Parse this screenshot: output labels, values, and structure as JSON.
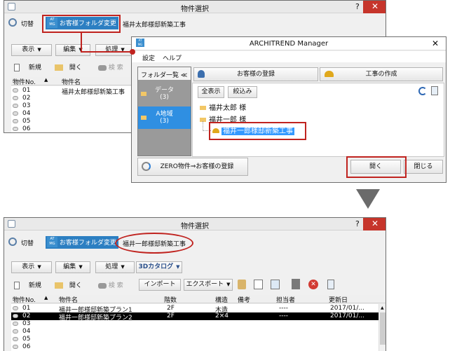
{
  "top": {
    "title": "物件選択",
    "help": "?",
    "close": "✕",
    "switch": "切替",
    "folder_change": "お客様フォルダ変更",
    "project_name": "福井太郎様邸新築工事",
    "menu": {
      "view": "表示",
      "edit": "編集",
      "process": "処理"
    },
    "tools": {
      "new": "新規",
      "open": "開く",
      "search": "検 索"
    },
    "headers": {
      "no": "物件No.",
      "name": "物件名"
    },
    "rows": [
      {
        "no": "01",
        "name": "福井太郎様邸新築工事"
      },
      {
        "no": "02",
        "name": ""
      },
      {
        "no": "03",
        "name": ""
      },
      {
        "no": "04",
        "name": ""
      },
      {
        "no": "05",
        "name": ""
      },
      {
        "no": "06",
        "name": ""
      }
    ]
  },
  "mgr": {
    "title": "ARCHITREND Manager",
    "close": "✕",
    "menu": {
      "settings": "設定",
      "help": "ヘルプ"
    },
    "folder_list": "フォルダ一覧 ≪",
    "folders": [
      {
        "name": "データ",
        "count": "(3)"
      },
      {
        "name": "A地域",
        "count": "(3)"
      }
    ],
    "register_customer": "お客様の登録",
    "create_project": "工事の作成",
    "show_all": "全表示",
    "filter": "絞込み",
    "tree": {
      "customer1": "福井太郎 様",
      "customer2": "福井一郎 様",
      "project": "福井一郎様邸新築工事"
    },
    "zero": "ZERO物件⇒お客様の登録",
    "open": "開く",
    "close_btn": "閉じる"
  },
  "bottom": {
    "title": "物件選択",
    "help": "?",
    "close": "✕",
    "switch": "切替",
    "folder_change": "お客様フォルダ変更",
    "project_name": "福井一郎様邸新築工事",
    "menu": {
      "view": "表示",
      "edit": "編集",
      "process": "処理",
      "catalog": "3Dカタログ"
    },
    "tools": {
      "new": "新規",
      "open": "開く",
      "search": "検 索",
      "import": "インポート",
      "export": "エクスポート"
    },
    "headers": {
      "no": "物件No.",
      "name": "物件名",
      "floors": "階数",
      "structure": "構造",
      "note": "備考",
      "person": "担当者",
      "updated": "更新日"
    },
    "rows": [
      {
        "no": "01",
        "name": "福井一郎様邸新築プラン1",
        "floors": "2F",
        "structure": "木造",
        "person": "----",
        "updated": "2017/01/..."
      },
      {
        "no": "02",
        "name": "福井一郎様邸新築プラン2",
        "floors": "2F",
        "structure": "2×4",
        "person": "----",
        "updated": "2017/01/..."
      },
      {
        "no": "03",
        "name": "",
        "floors": "",
        "structure": "",
        "person": "",
        "updated": ""
      },
      {
        "no": "04",
        "name": "",
        "floors": "",
        "structure": "",
        "person": "",
        "updated": ""
      },
      {
        "no": "05",
        "name": "",
        "floors": "",
        "structure": "",
        "person": "",
        "updated": ""
      },
      {
        "no": "06",
        "name": "",
        "floors": "",
        "structure": "",
        "person": "",
        "updated": ""
      }
    ]
  },
  "colors": {
    "accent_red": "#c0231f",
    "selection": "#3399ff",
    "atmg_blue": "#3b8fcf"
  }
}
